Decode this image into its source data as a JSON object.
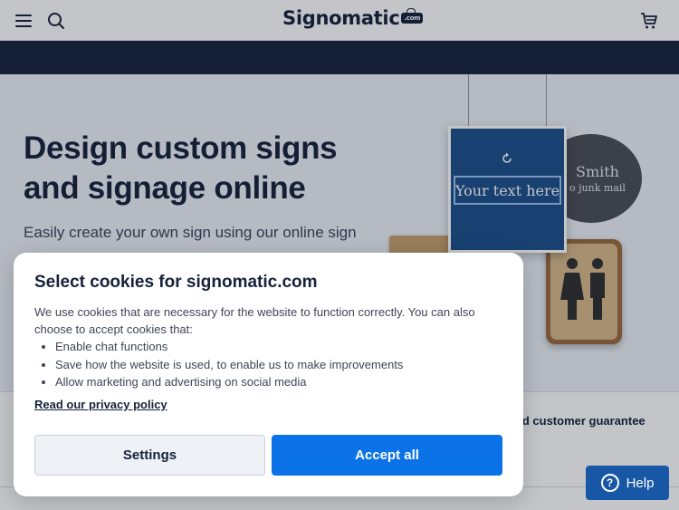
{
  "header": {
    "logo_text": "Signomatic",
    "logo_badge": ".com",
    "icons": [
      "menu-icon",
      "search-icon",
      "cart-icon"
    ]
  },
  "hero": {
    "title": "Design custom signs and signage online",
    "subtitle": "Easily create your own sign using our online sign",
    "sign_blue_text": "Your text here",
    "sign_oval_name": "Smith",
    "sign_oval_note": "o junk mail"
  },
  "guarantee": {
    "text": "ied customer guarantee"
  },
  "cookie": {
    "title": "Select cookies for signomatic.com",
    "intro": "We use cookies that are necessary for the website to function correctly. You can also choose to accept cookies that:",
    "items": [
      "Enable chat functions",
      "Save how the website is used, to enable us to make improvements",
      "Allow marketing and advertising on social media"
    ],
    "privacy_link": "Read our privacy policy",
    "settings_label": "Settings",
    "accept_label": "Accept all"
  },
  "help": {
    "label": "Help",
    "icon_glyph": "?"
  },
  "colors": {
    "brand_navy": "#16213a",
    "accept_blue": "#0b72e7",
    "help_blue": "#1857a6",
    "hero_bg": "#eef1f6"
  }
}
